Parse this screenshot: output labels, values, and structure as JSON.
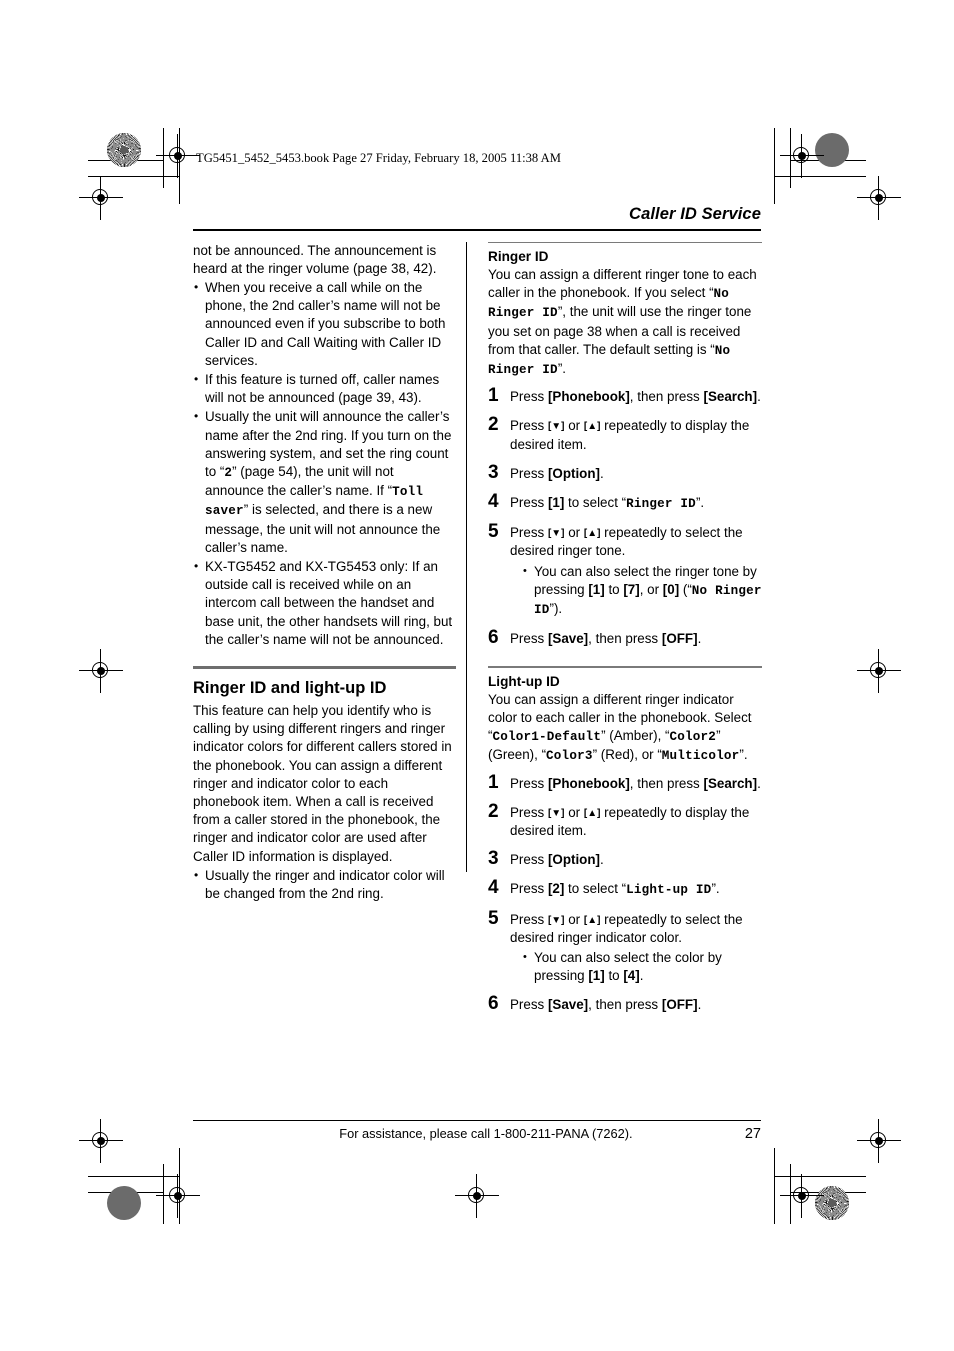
{
  "page_slug": "TG5451_5452_5453.book  Page 27  Friday, February 18, 2005  11:38 AM",
  "running_head": "Caller ID Service",
  "footer": {
    "assistance_text": "For assistance, please call 1-800-211-PANA (7262).",
    "page_number": "27"
  },
  "left_column": {
    "continued_paragraph": {
      "part1": "not be announced. The announcement is heard at the ringer volume (page 38, 42)."
    },
    "bullets": [
      {
        "text": "When you receive a call while on the phone, the 2nd caller’s name will not be announced even if you subscribe to both Caller ID and Call Waiting with Caller ID services."
      },
      {
        "text": "If this feature is turned off, caller names will not be announced (page 39, 43)."
      },
      {
        "seg1": "Usually the unit will announce the caller’s name after the 2nd ring. If you turn on the answering system, and set the ring count to “",
        "lcd1": "2",
        "seg2": "” (page 54), the unit will not announce the caller’s name. If “",
        "lcd2": "Toll saver",
        "seg3": "” is selected, and there is a new message, the unit will not announce the caller’s name."
      },
      {
        "text": "KX-TG5452 and KX-TG5453 only: If an outside call is received while on an intercom call between the handset and base unit, the other handsets will ring, but the caller’s name will not be announced."
      }
    ],
    "section": {
      "title": "Ringer ID and light-up ID",
      "intro": "This feature can help you identify who is calling by using different ringers and ringer indicator colors for different callers stored in the phonebook. You can assign a different ringer and indicator color to each phonebook item. When a call is received from a caller stored in the phonebook, the ringer and indicator color are used after Caller ID information is displayed.",
      "bullets": [
        {
          "text": "Usually the ringer and indicator color will be changed from the 2nd ring."
        }
      ]
    }
  },
  "right_column": {
    "ringer_id": {
      "title": "Ringer ID",
      "intro_seg1": "You can assign a different ringer tone to each caller in the phonebook. If you select “",
      "intro_lcd1": "No Ringer ID",
      "intro_seg2": "”, the unit will use the ringer tone you set on page 38 when a call is received from that caller. The default setting is “",
      "intro_lcd2": "No Ringer ID",
      "intro_seg3": "”.",
      "steps": [
        {
          "num": "1",
          "seg1": "Press ",
          "key1": "[Phonebook]",
          "seg2": ", then press ",
          "key2": "[Search]",
          "seg3": "."
        },
        {
          "num": "2",
          "seg1": "Press ",
          "key1": "[▼]",
          "seg2": " or ",
          "key2": "[▲]",
          "seg3": " repeatedly to display the desired item."
        },
        {
          "num": "3",
          "seg1": "Press ",
          "key1": "[Option]",
          "seg2": "."
        },
        {
          "num": "4",
          "seg1": "Press ",
          "key1": "[1]",
          "seg2": " to select “",
          "lcd1": "Ringer ID",
          "seg3": "”."
        },
        {
          "num": "5",
          "seg1": "Press ",
          "key1": "[▼]",
          "seg2": " or ",
          "key2": "[▲]",
          "seg3": " repeatedly to select the desired ringer tone.",
          "subbullet": {
            "seg1": "You can also select the ringer tone by pressing ",
            "key1": "[1]",
            "seg2": " to ",
            "key2": "[7]",
            "seg3": ", or ",
            "key3": "[0]",
            "seg4": " (“",
            "lcd1": "No Ringer ID",
            "seg5": "”)."
          }
        },
        {
          "num": "6",
          "seg1": "Press ",
          "key1": "[Save]",
          "seg2": ", then press ",
          "key2": "[OFF]",
          "seg3": "."
        }
      ]
    },
    "light_up_id": {
      "title": "Light-up ID",
      "intro_seg1": "You can assign a different ringer indicator color to each caller in the phonebook. Select “",
      "intro_lcd1": "Color1-Default",
      "intro_seg2": "” (Amber), “",
      "intro_lcd2": "Color2",
      "intro_seg3": "” (Green), “",
      "intro_lcd3": "Color3",
      "intro_seg4": "” (Red), or “",
      "intro_lcd4": "Multicolor",
      "intro_seg5": "”.",
      "steps": [
        {
          "num": "1",
          "seg1": "Press ",
          "key1": "[Phonebook]",
          "seg2": ", then press ",
          "key2": "[Search]",
          "seg3": "."
        },
        {
          "num": "2",
          "seg1": "Press ",
          "key1": "[▼]",
          "seg2": " or ",
          "key2": "[▲]",
          "seg3": " repeatedly to display the desired item."
        },
        {
          "num": "3",
          "seg1": "Press ",
          "key1": "[Option]",
          "seg2": "."
        },
        {
          "num": "4",
          "seg1": "Press ",
          "key1": "[2]",
          "seg2": " to select “",
          "lcd1": "Light-up ID",
          "seg3": "”."
        },
        {
          "num": "5",
          "seg1": "Press ",
          "key1": "[▼]",
          "seg2": " or ",
          "key2": "[▲]",
          "seg3": " repeatedly to select the desired ringer indicator color.",
          "subbullet": {
            "seg1": "You can also select the color by pressing ",
            "key1": "[1]",
            "seg2": " to ",
            "key2": "[4]",
            "seg3": "."
          }
        },
        {
          "num": "6",
          "seg1": "Press ",
          "key1": "[Save]",
          "seg2": ", then press ",
          "key2": "[OFF]",
          "seg3": "."
        }
      ]
    }
  }
}
